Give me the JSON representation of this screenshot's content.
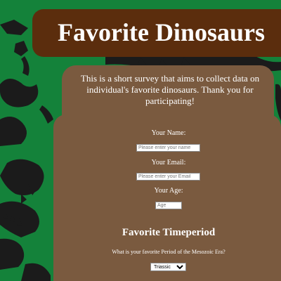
{
  "header": {
    "title": "Favorite Dinosaurs"
  },
  "intro": {
    "text": "This is a short survey that aims to collect data on individual's favorite dinosaurs. Thank you for participating!"
  },
  "form": {
    "name_label": "Your Name:",
    "name_placeholder": "Please enter your name",
    "email_label": "Your Email:",
    "email_placeholder": "Please enter your Email",
    "age_label": "Your Age:",
    "age_placeholder": "Age"
  },
  "timeperiod": {
    "heading": "Favorite Timeperiod",
    "question": "What is your favorite Period of the Mesozoic Era?",
    "selected": "Triassic"
  },
  "colors": {
    "background": "#14823a",
    "banner": "#5b2d0d",
    "panel": "#7a5a3f",
    "silhouette": "#1b1b1b"
  },
  "icons": [
    "dinosaur-skeleton-silhouette"
  ]
}
